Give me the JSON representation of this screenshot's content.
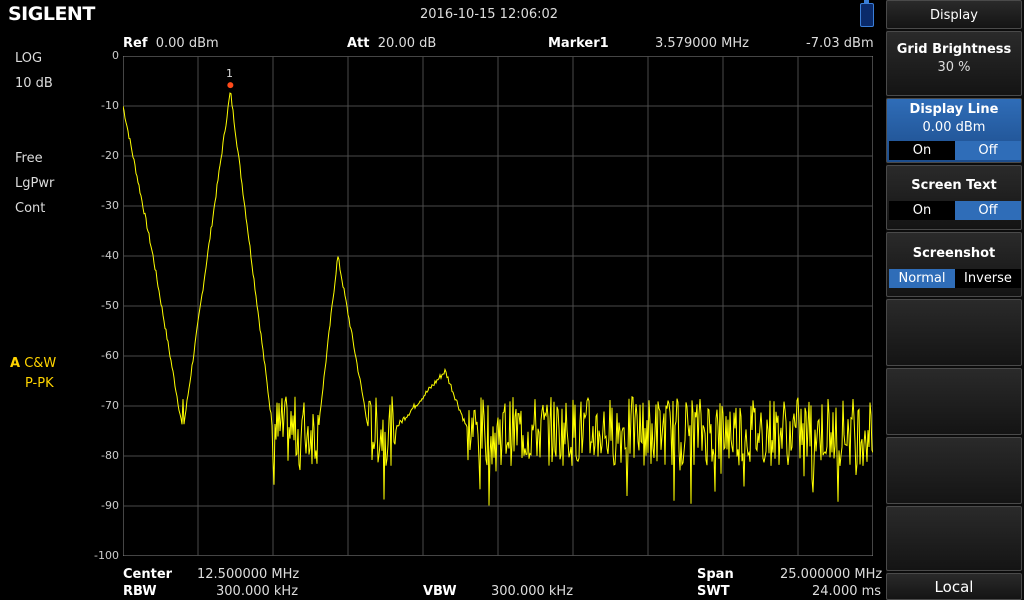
{
  "header": {
    "logo": "SIGLENT",
    "datetime": "2016-10-15   12:06:02",
    "usb_icon": "usb-icon"
  },
  "topbar": {
    "ref_label": "Ref",
    "ref_value": "0.00 dBm",
    "att_label": "Att",
    "att_value": "20.00 dB",
    "marker_label": "Marker1",
    "marker_freq": "3.579000 MHz",
    "marker_level": "-7.03 dBm"
  },
  "left": {
    "scale": "LOG",
    "div": "10 dB",
    "free": "Free",
    "lgpwr": "LgPwr",
    "cont": "Cont",
    "trace_letter": "A",
    "trace_mode": "C&W",
    "detector": "P-PK"
  },
  "marker_num": "1",
  "bottom": {
    "center_label": "Center",
    "center_value": "12.500000 MHz",
    "rbw_label": "RBW",
    "rbw_value": "300.000 kHz",
    "vbw_label": "VBW",
    "vbw_value": "300.000 kHz",
    "span_label": "Span",
    "span_value": "25.000000 MHz",
    "swt_label": "SWT",
    "swt_value": "24.000 ms"
  },
  "panel": {
    "title": "Display",
    "grid_brightness": {
      "label": "Grid Brightness",
      "value": "30 %"
    },
    "display_line": {
      "label": "Display Line",
      "value": "0.00 dBm",
      "on": "On",
      "off": "Off",
      "selected": "Off"
    },
    "screen_text": {
      "label": "Screen Text",
      "on": "On",
      "off": "Off",
      "selected": "Off"
    },
    "screenshot": {
      "label": "Screenshot",
      "normal": "Normal",
      "inverse": "Inverse",
      "selected": "Normal"
    },
    "local": "Local"
  },
  "chart_data": {
    "type": "line",
    "yticks": [
      "0",
      "-10",
      "-20",
      "-30",
      "-40",
      "-50",
      "-60",
      "-70",
      "-80",
      "-90",
      "-100"
    ],
    "ylim": [
      -100,
      0
    ],
    "xlim": [
      0,
      25
    ],
    "grid": true,
    "trace_color": "#ffff00",
    "noise_floor": -75,
    "series": [
      {
        "x": [
          0,
          1.0,
          2.0,
          3.58,
          5.0,
          6.5,
          7.16,
          8.2,
          9.0,
          10.74,
          11.5,
          25.0
        ],
        "y": [
          -10,
          -40,
          -75,
          -7.03,
          -75,
          -75,
          -40,
          -75,
          -75,
          -63,
          -75,
          -75
        ]
      }
    ],
    "marker": {
      "x": 3.579,
      "y": -7.03
    }
  }
}
